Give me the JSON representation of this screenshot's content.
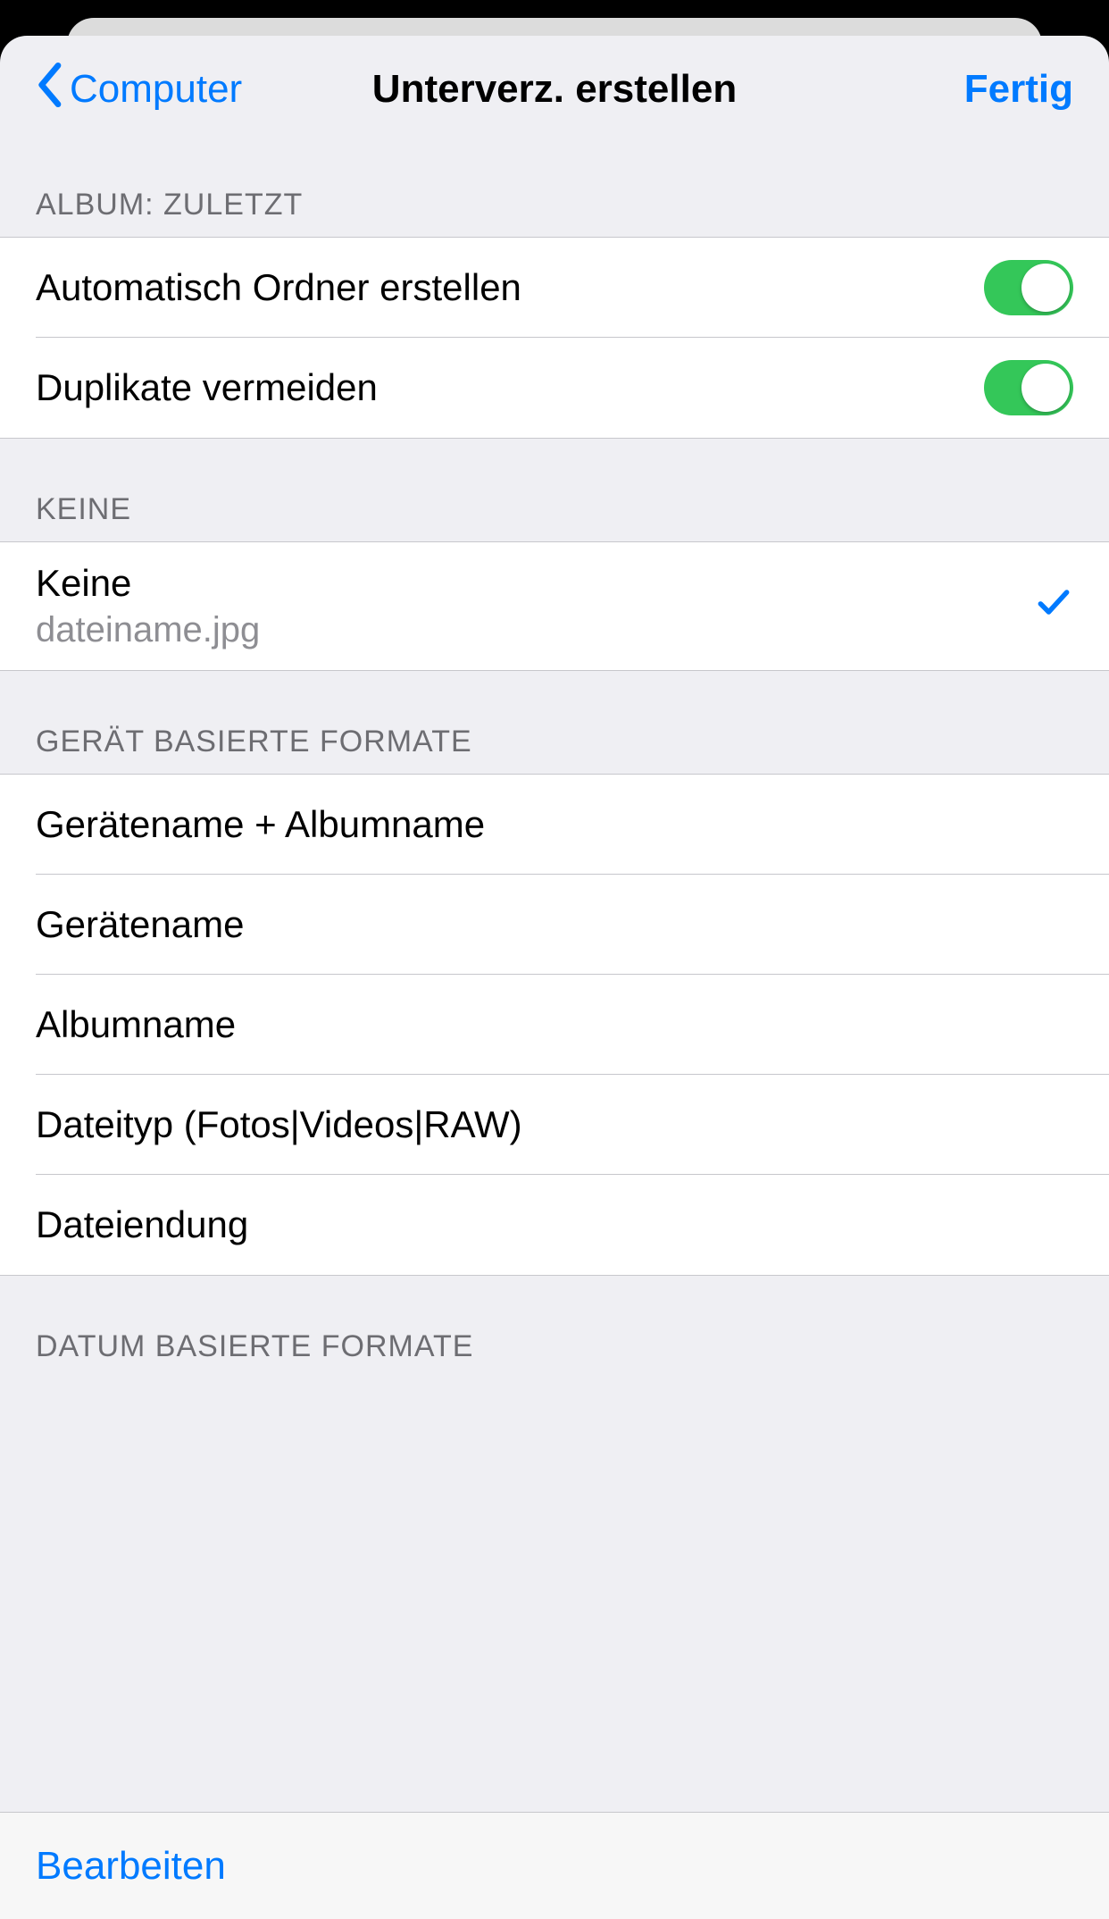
{
  "nav": {
    "back_label": "Computer",
    "title": "Unterverz. erstellen",
    "done_label": "Fertig"
  },
  "sections": {
    "album": {
      "header": "ALBUM: ZULETZT",
      "auto_create_label": "Automatisch Ordner erstellen",
      "avoid_duplicates_label": "Duplikate vermeiden"
    },
    "none": {
      "header": "KEINE",
      "title": "Keine",
      "subtitle": "dateiname.jpg"
    },
    "device": {
      "header": "GERÄT BASIERTE FORMATE",
      "items": [
        "Gerätename + Albumname",
        "Gerätename",
        "Albumname",
        "Dateityp (Fotos|Videos|RAW)",
        "Dateiendung"
      ]
    },
    "date": {
      "header": "DATUM BASIERTE FORMATE"
    }
  },
  "toolbar": {
    "edit_label": "Bearbeiten"
  }
}
